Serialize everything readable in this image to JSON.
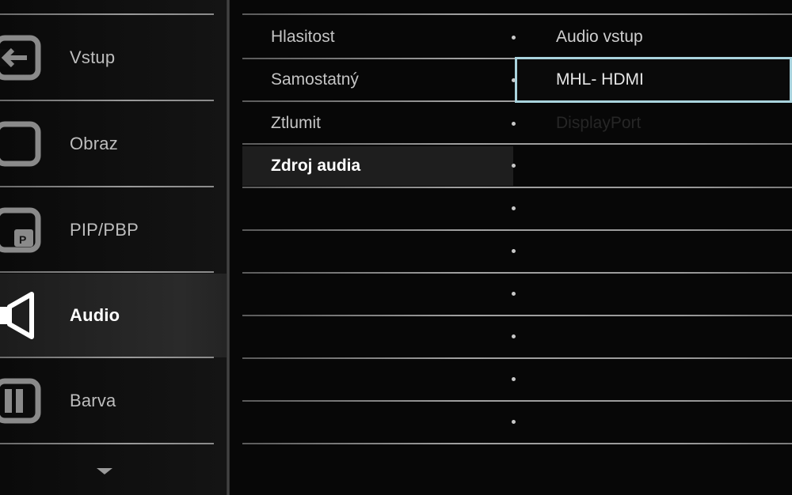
{
  "sidebar": {
    "items": [
      {
        "label": "Vstup",
        "icon": "input-icon",
        "active": false
      },
      {
        "label": "Obraz",
        "icon": "picture-icon",
        "active": false
      },
      {
        "label": "PIP/PBP",
        "icon": "pip-icon",
        "active": false
      },
      {
        "label": "Audio",
        "icon": "speaker-icon",
        "active": true
      },
      {
        "label": "Barva",
        "icon": "color-icon",
        "active": false
      }
    ],
    "scroll_icon": "chevron-down-icon"
  },
  "menu": {
    "items": [
      {
        "label": "Hlasitost"
      },
      {
        "label": "Samostatný"
      },
      {
        "label": "Ztlumit"
      },
      {
        "label": "Zdroj audia",
        "selected": true
      }
    ]
  },
  "submenu": {
    "header": "Audio vstup",
    "options": [
      {
        "label": "MHL- HDMI",
        "state": "highlighted"
      },
      {
        "label": "DisplayPort",
        "state": "disabled"
      }
    ]
  },
  "colors": {
    "background": "#070707",
    "highlight_border": "#a9d3dd",
    "active_text": "#ffffff",
    "text": "#c4c4c4"
  }
}
